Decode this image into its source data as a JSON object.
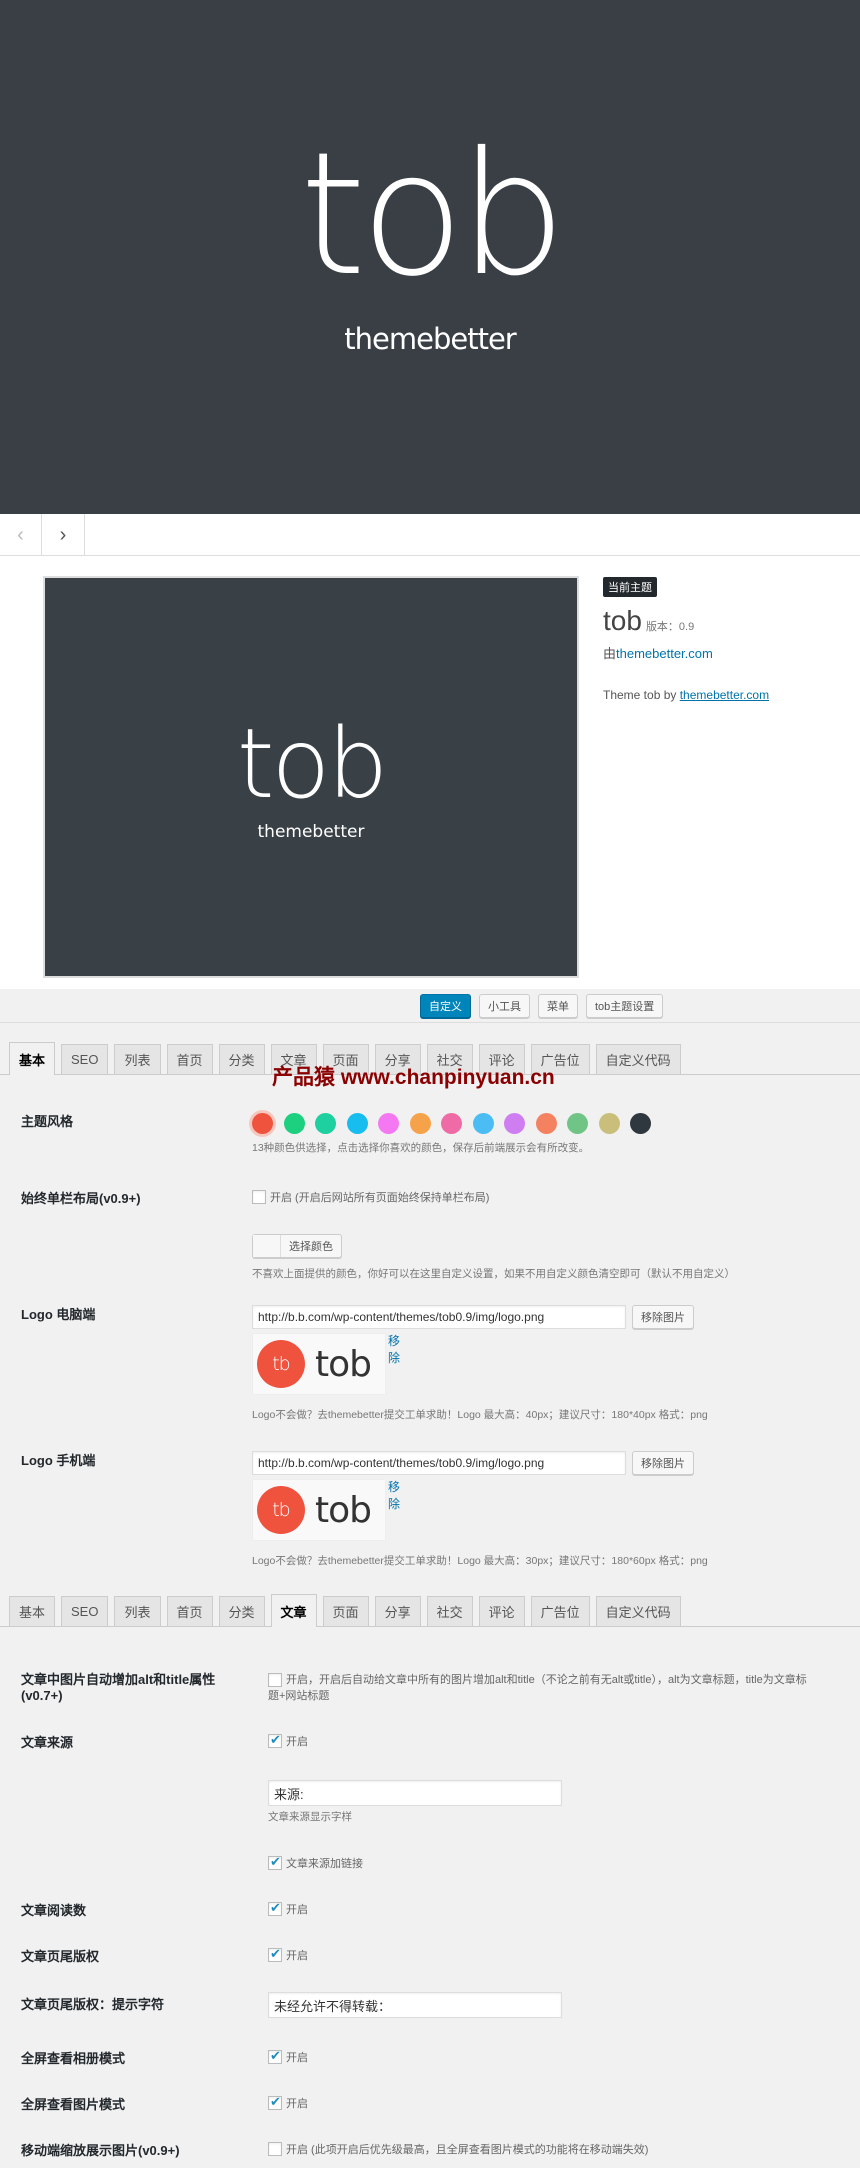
{
  "hero": {
    "logo": "tob",
    "tagline": "themebetter"
  },
  "theme_detail": {
    "nav": {
      "prev_icon": "‹",
      "next_icon": "›"
    },
    "screenshot": {
      "logo": "tob",
      "tagline": "themebetter"
    },
    "badge": "当前主题",
    "name": "tob",
    "version_label": "版本：0.9",
    "author_prefix": "由",
    "author_link": "themebetter.com",
    "description_prefix": "Theme tob by ",
    "description_link": "themebetter.com"
  },
  "actions": [
    {
      "label": "自定义",
      "primary": true
    },
    {
      "label": "小工具",
      "primary": false
    },
    {
      "label": "菜单",
      "primary": false
    },
    {
      "label": "tob主题设置",
      "primary": false
    }
  ],
  "tabs": [
    "基本",
    "SEO",
    "列表",
    "首页",
    "分类",
    "文章",
    "页面",
    "分享",
    "社交",
    "评论",
    "广告位",
    "自定义代码"
  ],
  "tabs_section1_active": "基本",
  "tabs_section2_active": "文章",
  "watermark": "产品猿 www.chanpinyuan.cn",
  "basic": {
    "theme_style": {
      "label": "主题风格",
      "colors": [
        "#ef533e",
        "#1dd07f",
        "#1ecfa0",
        "#16bdee",
        "#f478f1",
        "#f6a24a",
        "#ef6ba6",
        "#4cbdf4",
        "#cf7ef1",
        "#f48261",
        "#70c586",
        "#c9bf7a",
        "#2f383e"
      ],
      "selected_index": 0,
      "hint": "13种颜色供选择，点击选择你喜欢的颜色，保存后前端展示会有所改变。"
    },
    "single_column": {
      "label": "始终单栏布局(v0.9+)",
      "checked": false,
      "text": "开启  (开启后网站所有页面始终保持单栏布局)"
    },
    "custom_color": {
      "button": "选择颜色",
      "hint": "不喜欢上面提供的颜色，你好可以在这里自定义设置，如果不用自定义颜色清空即可（默认不用自定义）"
    },
    "logo_pc": {
      "label": "Logo 电脑端",
      "value": "http://b.b.com/wp-content/themes/tob0.9/img/logo.png",
      "remove_button": "移除图片",
      "remove_link": "移除",
      "preview_badge": "tb",
      "preview_word": "tob",
      "hint": "Logo不会做？去themebetter提交工单求助！Logo 最大高：40px；建议尺寸：180*40px 格式：png"
    },
    "logo_mobile": {
      "label": "Logo 手机端",
      "value": "http://b.b.com/wp-content/themes/tob0.9/img/logo.png",
      "remove_button": "移除图片",
      "remove_link": "移除",
      "preview_badge": "tb",
      "preview_word": "tob",
      "hint": "Logo不会做？去themebetter提交工单求助！Logo 最大高：30px；建议尺寸：180*60px 格式：png"
    }
  },
  "article": {
    "img_alt": {
      "label": "文章中图片自动增加alt和title属性(v0.7+)",
      "checked": false,
      "text": "开启，开启后自动给文章中所有的图片增加alt和title（不论之前有无alt或title），alt为文章标题，title为文章标题+网站标题"
    },
    "source": {
      "label": "文章来源",
      "checked": true,
      "text": "开启"
    },
    "source_text": {
      "value": "来源:",
      "hint": "文章来源显示字样"
    },
    "source_link": {
      "checked": true,
      "text": "文章来源加链接"
    },
    "read_count": {
      "label": "文章阅读数",
      "checked": true,
      "text": "开启"
    },
    "footer_copyright": {
      "label": "文章页尾版权",
      "checked": true,
      "text": "开启"
    },
    "footer_copyright_text": {
      "label": "文章页尾版权：提示字符",
      "value": "未经允许不得转载："
    },
    "gallery_fullscreen": {
      "label": "全屏查看相册模式",
      "checked": true,
      "text": "开启"
    },
    "image_fullscreen": {
      "label": "全屏查看图片模式",
      "checked": true,
      "text": "开启"
    },
    "mobile_zoom": {
      "label": "移动端缩放展示图片(v0.9+)",
      "checked": false,
      "text": "开启  (此项开启后优先级最高，且全屏查看图片模式的功能将在移动端失效)"
    }
  }
}
